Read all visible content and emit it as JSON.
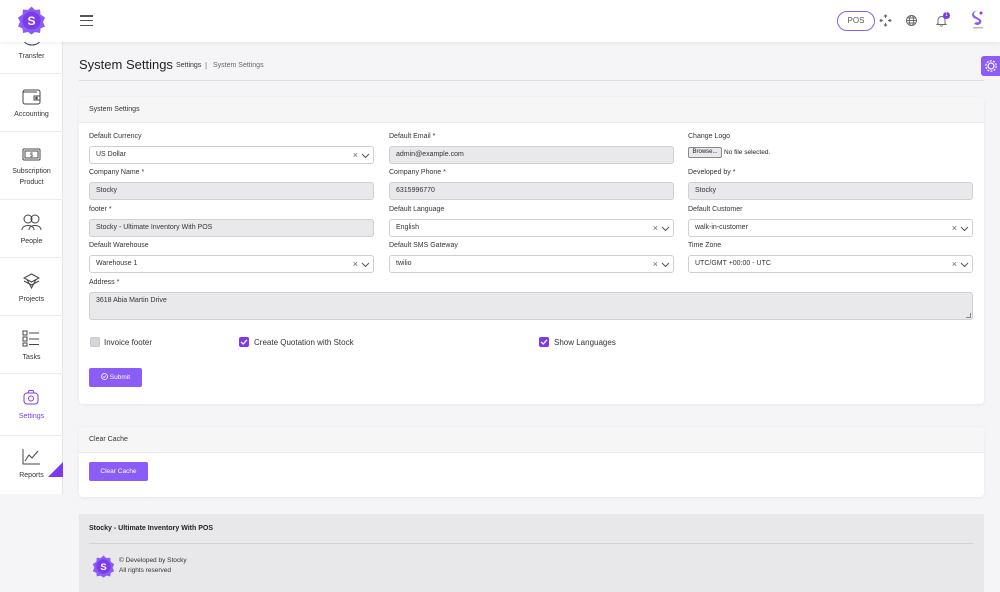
{
  "topbar": {
    "logo_letter": "S",
    "pos_label": "POS",
    "notification_count": "1",
    "brand_color": "#7c3aed",
    "icons": [
      "menu-icon",
      "fullscreen-icon",
      "globe-icon",
      "bell-icon",
      "user-avatar-icon"
    ]
  },
  "sidebar": {
    "items": [
      {
        "label": "Transfer",
        "icon": "transfer-icon"
      },
      {
        "label": "Accounting",
        "icon": "wallet-icon"
      },
      {
        "label": "Subscription Product",
        "icon": "money-icon"
      },
      {
        "label": "People",
        "icon": "people-icon"
      },
      {
        "label": "Projects",
        "icon": "layers-icon"
      },
      {
        "label": "Tasks",
        "icon": "tasks-icon"
      },
      {
        "label": "Settings",
        "icon": "settings-icon",
        "active": true
      },
      {
        "label": "Reports",
        "icon": "chart-icon"
      }
    ]
  },
  "page": {
    "title": "System Settings",
    "breadcrumb": [
      "Settings",
      "|",
      "System Settings"
    ]
  },
  "system_settings": {
    "card_title": "System Settings",
    "default_currency": {
      "label": "Default Currency",
      "value": "US Dollar"
    },
    "default_email": {
      "label": "Default Email *",
      "value": "admin@example.com"
    },
    "change_logo": {
      "label": "Change Logo",
      "browse": "Browse...",
      "status": "No file selected."
    },
    "company_name": {
      "label": "Company Name *",
      "value": "Stocky"
    },
    "company_phone": {
      "label": "Company Phone *",
      "value": "6315996770"
    },
    "developed_by": {
      "label": "Developed by *",
      "value": "Stocky"
    },
    "footer": {
      "label": "footer *",
      "value": "Stocky - Ultimate Inventory With POS"
    },
    "default_language": {
      "label": "Default Language",
      "value": "English"
    },
    "default_customer": {
      "label": "Default Customer",
      "value": "walk-in-customer"
    },
    "default_warehouse": {
      "label": "Default Warehouse",
      "value": "Warehouse 1"
    },
    "default_sms_gateway": {
      "label": "Default SMS Gateway",
      "value": "twilio"
    },
    "time_zone": {
      "label": "Time Zone",
      "value": "UTC/GMT +00:00 - UTC"
    },
    "address": {
      "label": "Address *",
      "value": "3618  Abia Martin Drive"
    },
    "checkboxes": [
      {
        "label": "Invoice footer",
        "checked": false
      },
      {
        "label": "Create Quotation with Stock",
        "checked": true
      },
      {
        "label": "Show Languages",
        "checked": true
      }
    ],
    "submit_label": "Submit",
    "clear_symbol": "×"
  },
  "clear_cache": {
    "card_title": "Clear Cache",
    "button_label": "Clear Cache"
  },
  "footer": {
    "title": "Stocky - Ultimate Inventory With POS",
    "developed": "© Developed by Stocky",
    "rights": "All rights reserved"
  }
}
